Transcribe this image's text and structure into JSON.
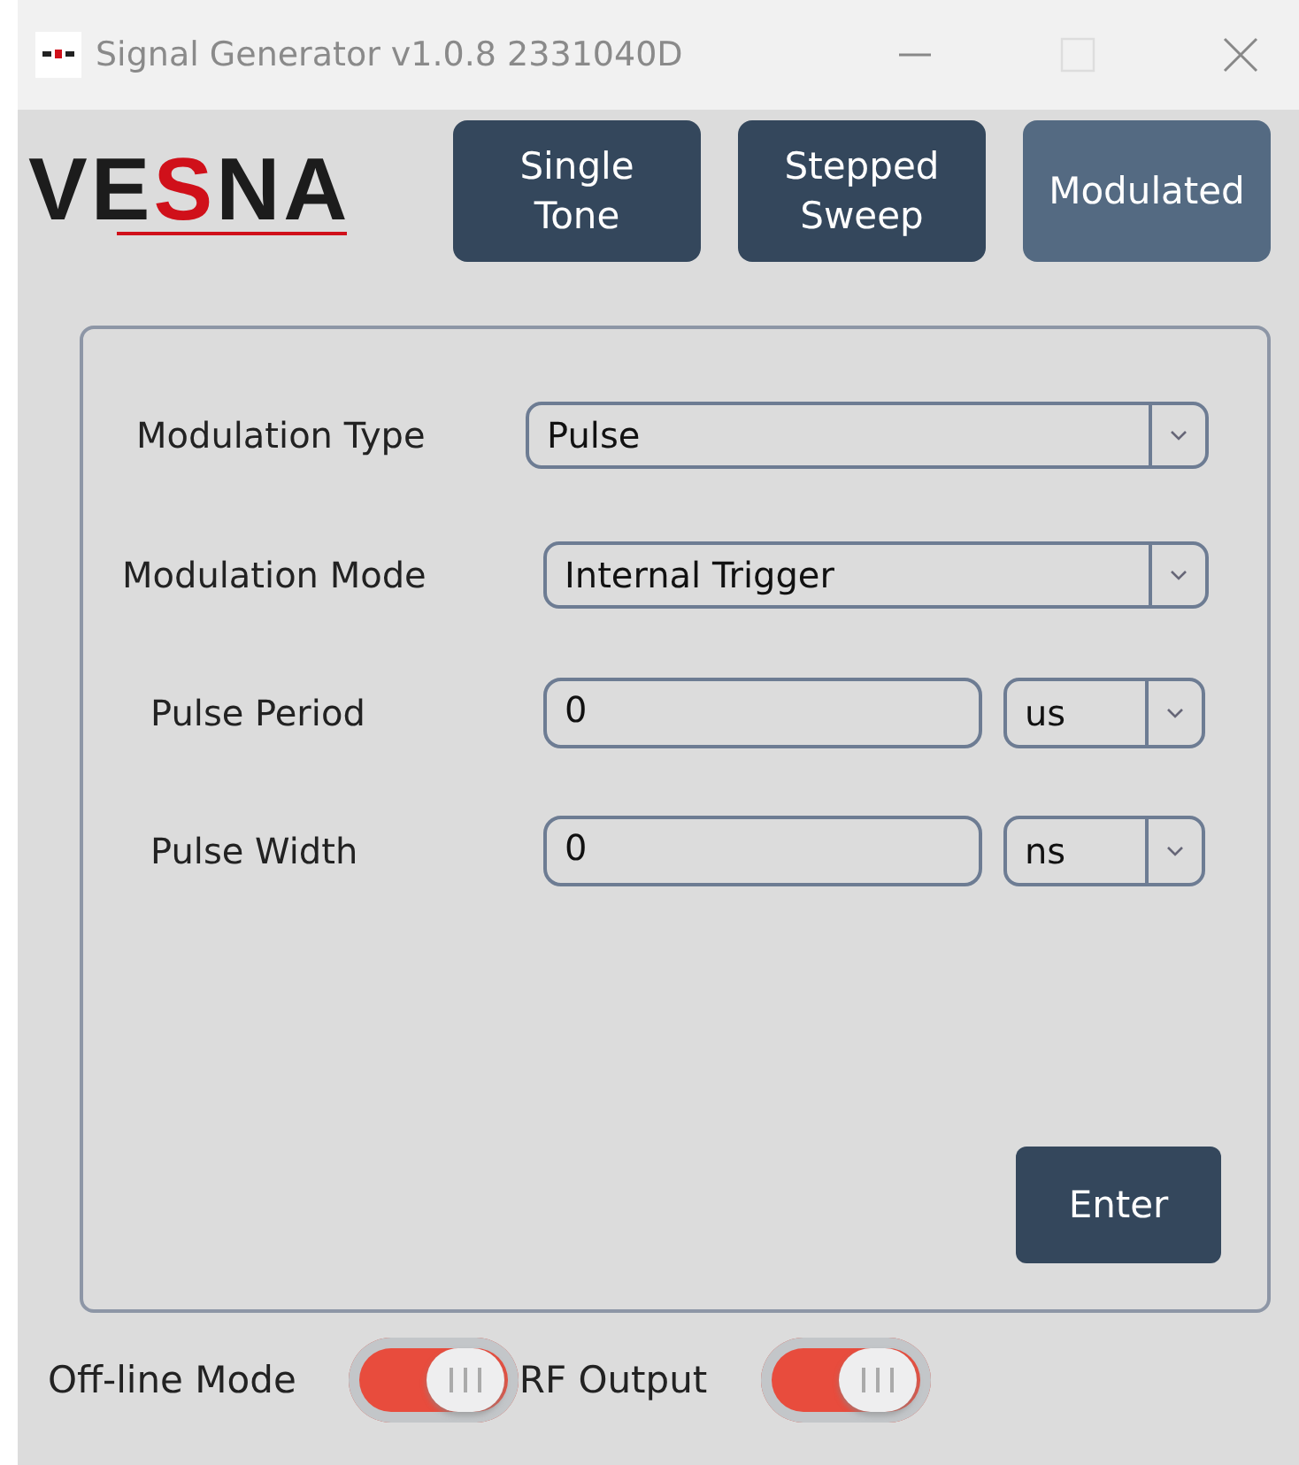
{
  "window": {
    "title": "Signal Generator v1.0.8 2331040D"
  },
  "logo": {
    "before": "VE",
    "accent": "S",
    "after": "NA"
  },
  "tabs": [
    {
      "label": "Single\nTone",
      "selected": false
    },
    {
      "label": "Stepped\nSweep",
      "selected": false
    },
    {
      "label": "Modulated",
      "selected": true
    }
  ],
  "fields": [
    {
      "kind": "select",
      "label": "Modulation Type",
      "value": "Pulse"
    },
    {
      "kind": "select",
      "label": "Modulation Mode",
      "value": "Internal Trigger"
    },
    {
      "kind": "number",
      "label": "Pulse Period",
      "value": "0",
      "unit": "us"
    },
    {
      "kind": "number",
      "label": "Pulse Width",
      "value": "0",
      "unit": "ns"
    }
  ],
  "enter_button": "Enter",
  "toggles": [
    {
      "label": "Off-line  Mode",
      "on": true
    },
    {
      "label": "RF Output",
      "on": true
    }
  ]
}
